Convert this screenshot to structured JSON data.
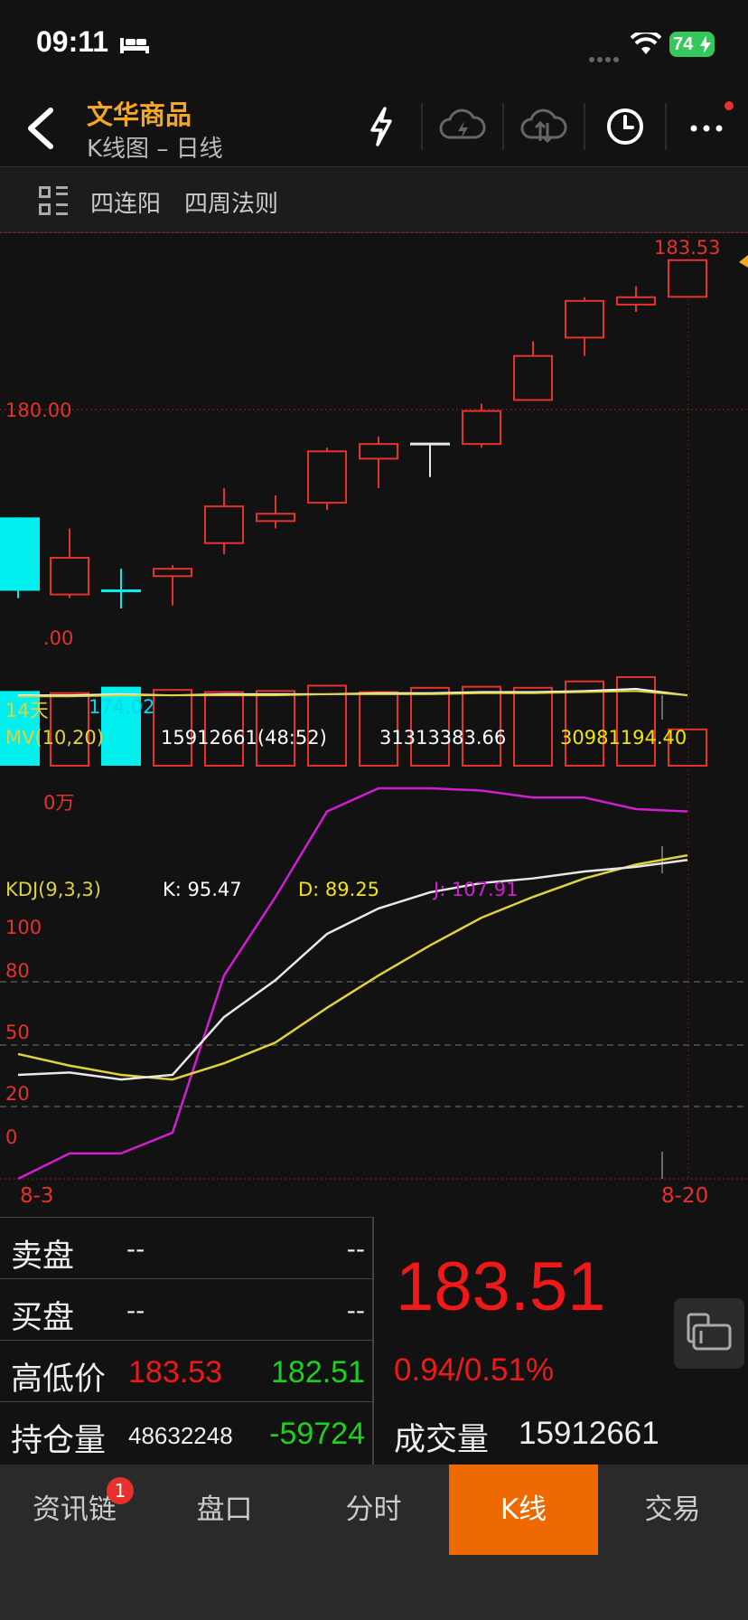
{
  "status": {
    "time": "09:11",
    "battery": "74"
  },
  "header": {
    "title": "文华商品",
    "subtitle": "K线图 – 日线"
  },
  "strategy": {
    "items": [
      "四连阳",
      "四周法则"
    ]
  },
  "price_chart": {
    "price_180": "180.00",
    "price_hidden": ".00",
    "high_label": "183.53",
    "period_label": "14天",
    "low_label": "174.02",
    "candles": [
      {
        "color": "cyan",
        "open": 176.5,
        "close": 174.5,
        "high": 176.5,
        "low": 174.3,
        "partial": true
      },
      {
        "color": "red",
        "open": 174.4,
        "close": 175.4,
        "high": 176.2,
        "low": 174.3
      },
      {
        "color": "cyan",
        "open": 174.5,
        "close": 174.5,
        "high": 175.1,
        "low": 174.02,
        "doji": true
      },
      {
        "color": "red",
        "open": 174.9,
        "close": 175.1,
        "high": 175.2,
        "low": 174.1
      },
      {
        "color": "red",
        "open": 175.8,
        "close": 176.8,
        "high": 177.3,
        "low": 175.5
      },
      {
        "color": "red",
        "open": 176.4,
        "close": 176.6,
        "high": 177.1,
        "low": 176.2
      },
      {
        "color": "red",
        "open": 176.9,
        "close": 178.3,
        "high": 178.4,
        "low": 176.7
      },
      {
        "color": "red",
        "open": 178.1,
        "close": 178.5,
        "high": 178.7,
        "low": 177.3
      },
      {
        "color": "white",
        "open": 178.5,
        "close": 178.5,
        "high": 178.5,
        "low": 177.6,
        "doji": true
      },
      {
        "color": "red",
        "open": 178.5,
        "close": 179.4,
        "high": 179.6,
        "low": 178.4
      },
      {
        "color": "red",
        "open": 179.7,
        "close": 180.9,
        "high": 181.3,
        "low": 179.7
      },
      {
        "color": "red",
        "open": 181.4,
        "close": 182.4,
        "high": 182.5,
        "low": 180.9
      },
      {
        "color": "red",
        "open": 182.3,
        "close": 182.5,
        "high": 182.8,
        "low": 182.1
      },
      {
        "color": "red",
        "open": 182.51,
        "close": 183.51,
        "high": 183.53,
        "low": 182.51
      }
    ]
  },
  "volume_chart": {
    "mv_label": "MV(10,20)",
    "vol_value": "15912661(48:52)",
    "mv10_value": "31313383.66",
    "mv20_value": "30981194.40",
    "unit_label": "0万",
    "bars": [
      {
        "color": "cyan",
        "value": 0.7
      },
      {
        "color": "red",
        "value": 0.68
      },
      {
        "color": "cyan",
        "value": 0.74
      },
      {
        "color": "red",
        "value": 0.71
      },
      {
        "color": "red",
        "value": 0.69
      },
      {
        "color": "red",
        "value": 0.7
      },
      {
        "color": "red",
        "value": 0.75
      },
      {
        "color": "red",
        "value": 0.69
      },
      {
        "color": "red",
        "value": 0.73
      },
      {
        "color": "red",
        "value": 0.74
      },
      {
        "color": "red",
        "value": 0.73
      },
      {
        "color": "red",
        "value": 0.79
      },
      {
        "color": "red",
        "value": 0.83
      },
      {
        "color": "red",
        "value": 0.34
      }
    ],
    "mv10": [
      0.66,
      0.66,
      0.67,
      0.66,
      0.67,
      0.67,
      0.67,
      0.68,
      0.68,
      0.69,
      0.69,
      0.7,
      0.72,
      0.66
    ],
    "mv20": [
      0.65,
      0.65,
      0.66,
      0.66,
      0.66,
      0.66,
      0.67,
      0.67,
      0.67,
      0.68,
      0.68,
      0.69,
      0.7,
      0.66
    ]
  },
  "kdj": {
    "label": "KDJ(9,3,3)",
    "k_label": "K: 95.47",
    "d_label": "D: 89.25",
    "j_label": "J: 107.91",
    "axis": [
      "100",
      "80",
      "50",
      "20",
      "0"
    ],
    "k": [
      26,
      27,
      24,
      26,
      51,
      67,
      87,
      98,
      105,
      109,
      111,
      114,
      116,
      119
    ],
    "d": [
      35,
      30,
      26,
      24,
      31,
      40,
      55,
      69,
      82,
      94,
      103,
      111,
      117,
      121
    ],
    "j": [
      -19,
      -8,
      -8,
      1,
      69,
      103,
      140,
      150,
      150,
      149,
      146,
      146,
      141,
      140
    ],
    "x_start": "8-3",
    "x_end": "8-20"
  },
  "quote": {
    "sell_label": "卖盘",
    "sell_v1": "--",
    "sell_v2": "--",
    "buy_label": "买盘",
    "buy_v1": "--",
    "buy_v2": "--",
    "hl_label": "高低价",
    "high": "183.53",
    "low": "182.51",
    "oi_label": "持仓量",
    "oi": "48632248",
    "oi_change": "-59724",
    "last": "183.51",
    "change": "0.94/0.51%",
    "vol_label": "成交量",
    "volume": "15912661"
  },
  "tabs": {
    "badge": "1",
    "items": [
      "资讯链",
      "盘口",
      "分时",
      "K线",
      "交易"
    ],
    "active": 3
  },
  "colors": {
    "red": "#e5322d",
    "cyan": "#00f0f0",
    "yellow": "#e0d23a",
    "magenta": "#d21ed2",
    "green": "#1fd11f",
    "orange": "#ee6900",
    "gold": "#f5a623"
  }
}
